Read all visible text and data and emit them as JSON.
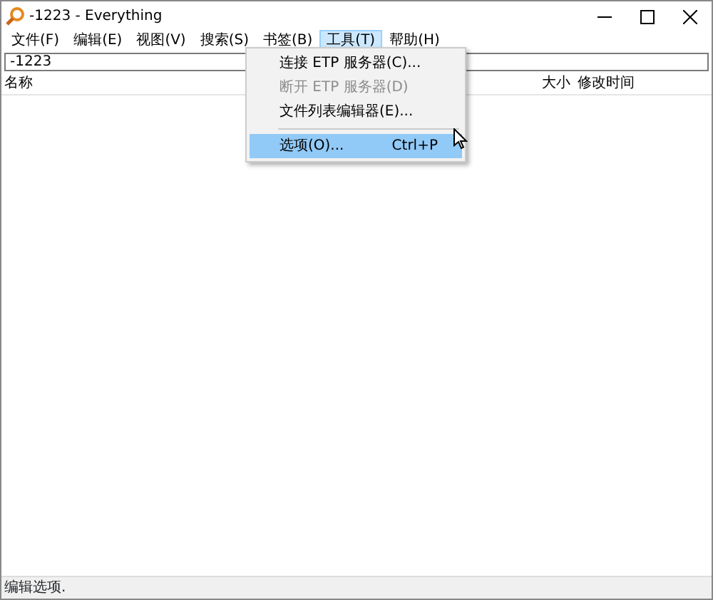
{
  "window": {
    "title": "-1223 - Everything"
  },
  "menu_bar": [
    {
      "label": "文件(F)",
      "selected": false
    },
    {
      "label": "编辑(E)",
      "selected": false
    },
    {
      "label": "视图(V)",
      "selected": false
    },
    {
      "label": "搜索(S)",
      "selected": false
    },
    {
      "label": "书签(B)",
      "selected": false
    },
    {
      "label": "工具(T)",
      "selected": true
    },
    {
      "label": "帮助(H)",
      "selected": false
    }
  ],
  "search": {
    "value": "-1223"
  },
  "columns": [
    {
      "label": "名称",
      "kind": "name"
    },
    {
      "label": "大小",
      "kind": "size"
    },
    {
      "label": "修改时间",
      "kind": "date"
    }
  ],
  "dropdown": [
    {
      "kind": "item",
      "label": "连接 ETP 服务器(C)...",
      "disabled": false,
      "selected": false
    },
    {
      "kind": "item",
      "label": "断开 ETP 服务器(D)",
      "disabled": true,
      "selected": false
    },
    {
      "kind": "item",
      "label": "文件列表编辑器(E)...",
      "disabled": false,
      "selected": false
    },
    {
      "kind": "separator"
    },
    {
      "kind": "item",
      "label": "选项(O)...",
      "shortcut": "Ctrl+P",
      "disabled": false,
      "selected": true
    }
  ],
  "status_bar": {
    "text": "编辑选项."
  }
}
